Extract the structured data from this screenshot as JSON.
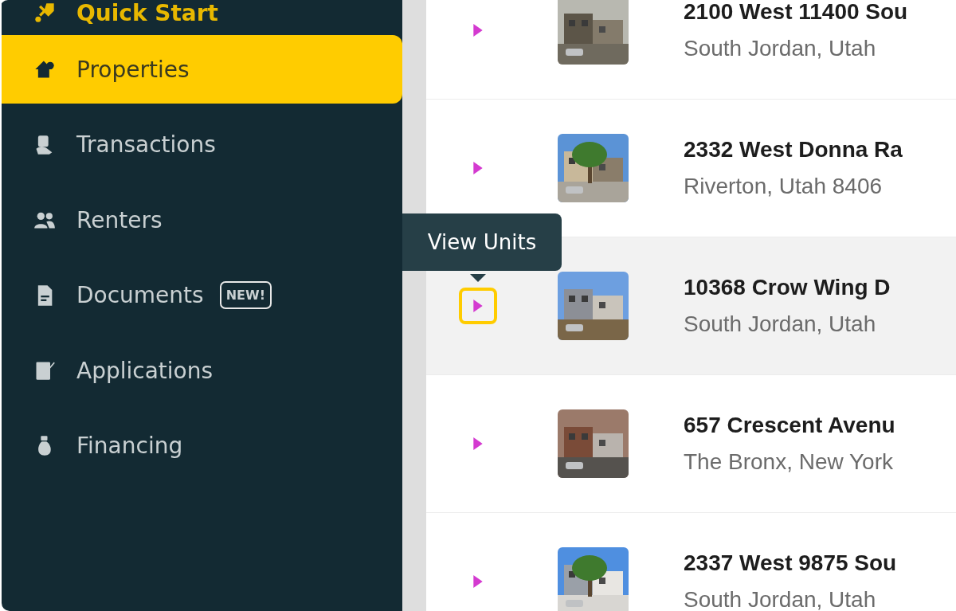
{
  "sidebar": {
    "items": [
      {
        "label": "Quick Start",
        "selected": false
      },
      {
        "label": "Properties",
        "selected": true
      },
      {
        "label": "Transactions",
        "selected": false
      },
      {
        "label": "Renters",
        "selected": false
      },
      {
        "label": "Documents",
        "selected": false,
        "badge": "NEW!"
      },
      {
        "label": "Applications",
        "selected": false
      },
      {
        "label": "Financing",
        "selected": false
      }
    ]
  },
  "tooltip": {
    "text": "View Units"
  },
  "properties": [
    {
      "address": "2100 West 11400 Sou",
      "city": "South Jordan, Utah",
      "highlighted": false,
      "focused": false
    },
    {
      "address": "2332 West Donna Ra",
      "city": "Riverton, Utah 8406",
      "highlighted": false,
      "focused": false
    },
    {
      "address": "10368 Crow Wing D",
      "city": "South Jordan, Utah",
      "highlighted": true,
      "focused": true
    },
    {
      "address": "657 Crescent Avenu",
      "city": "The Bronx, New York",
      "highlighted": false,
      "focused": false
    },
    {
      "address": "2337 West 9875 Sou",
      "city": "South Jordan, Utah",
      "highlighted": false,
      "focused": false
    }
  ]
}
